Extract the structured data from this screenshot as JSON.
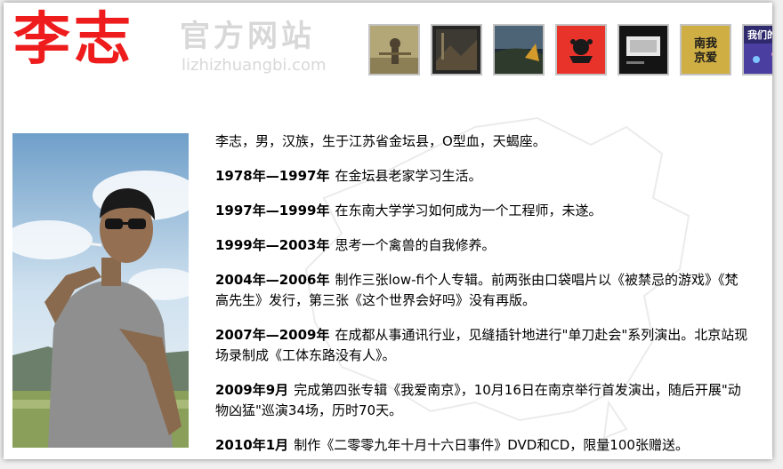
{
  "header": {
    "logo_text": "李志",
    "subtitle": "官方网站",
    "domain": "lizhizhuangbi.com"
  },
  "albums": [
    {
      "name": "album-cover-1",
      "color": "#a89b6a"
    },
    {
      "name": "album-cover-2",
      "color": "#2a2a28"
    },
    {
      "name": "album-cover-3",
      "color": "#3b4b5a"
    },
    {
      "name": "album-cover-4",
      "color": "#e8332a"
    },
    {
      "name": "album-cover-5",
      "color": "#1c1c1c"
    },
    {
      "name": "album-cover-6",
      "color": "#c9a63a",
      "text": "南我京爱"
    },
    {
      "name": "album-cover-7",
      "color": "#3a2f7a",
      "text": "我们的"
    }
  ],
  "bio": {
    "intro": "李志，男，汉族，生于江苏省金坛县，O型血，天蝎座。",
    "entries": [
      {
        "years": "1978年—1997年",
        "text": "在金坛县老家学习生活。"
      },
      {
        "years": "1997年—1999年",
        "text": "在东南大学学习如何成为一个工程师，未遂。"
      },
      {
        "years": "1999年—2003年",
        "text": "思考一个禽兽的自我修养。"
      },
      {
        "years": "2004年—2006年",
        "text": "制作三张low-fi个人专辑。前两张由口袋唱片以《被禁忌的游戏》《梵高先生》发行，第三张《这个世界会好吗》没有再版。"
      },
      {
        "years": "2007年—2009年",
        "text": "在成都从事通讯行业，见缝插针地进行\"单刀赴会\"系列演出。北京站现场录制成《工体东路没有人》。"
      },
      {
        "years": "2009年9月",
        "text": "完成第四张专辑《我爱南京》，10月16日在南京举行首发演出，随后开展\"动物凶猛\"巡演34场，历时70天。"
      },
      {
        "years": "2010年1月",
        "text": "制作《二零零九年十月十六日事件》DVD和CD，限量100张赠送。"
      }
    ]
  },
  "colors": {
    "logo": "#ee1c1c",
    "subtitle": "#d8d8d8",
    "album_border": "#c4c4c4"
  }
}
